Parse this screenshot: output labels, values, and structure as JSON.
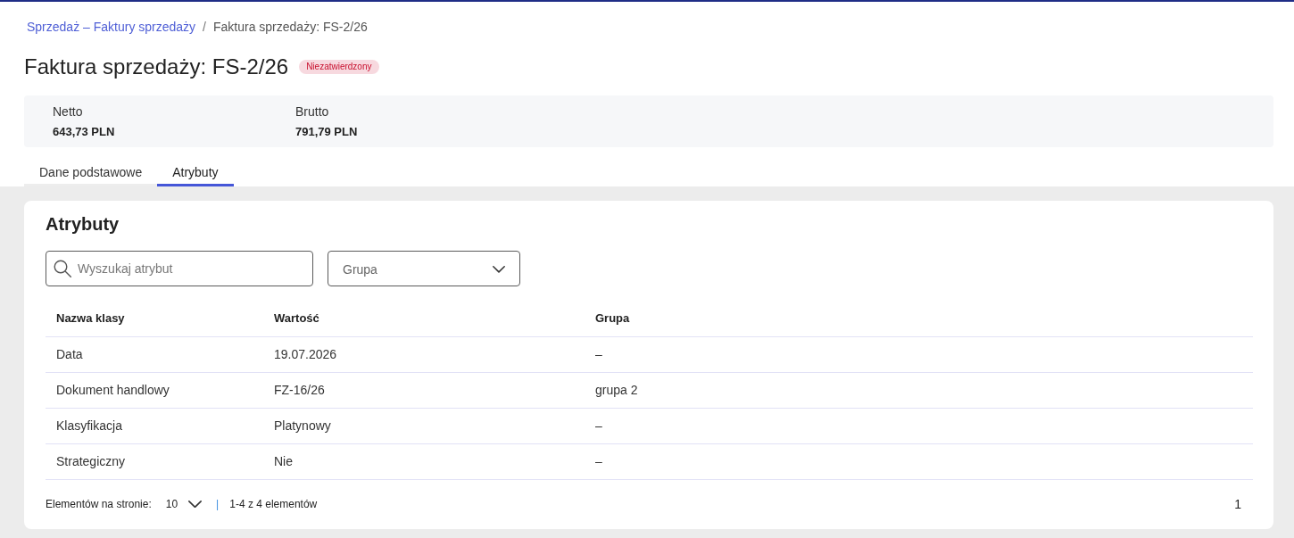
{
  "breadcrumb": {
    "separator": "/",
    "items": [
      {
        "label": "Sprzedaż – Faktury sprzedaży",
        "kind": "link"
      },
      {
        "label": "Faktura sprzedaży: FS-2/26",
        "kind": "current"
      }
    ]
  },
  "title": "Faktura sprzedaży: FS-2/26",
  "status": "Niezatwierdzony",
  "summary": [
    {
      "label": "Netto",
      "value": "643,73 PLN"
    },
    {
      "label": "Brutto",
      "value": "791,79 PLN"
    }
  ],
  "tabs": [
    {
      "label": "Dane podstawowe",
      "selected": false
    },
    {
      "label": "Atrybuty",
      "selected": true
    }
  ],
  "panel": {
    "title": "Atrybuty",
    "search": {
      "placeholder": "Wyszukaj atrybut"
    },
    "group_filter": {
      "placeholder": "Grupa"
    },
    "table": {
      "columns": [
        "Nazwa klasy",
        "Wartość",
        "Grupa"
      ],
      "rows": [
        [
          "Data",
          "19.07.2026",
          "–"
        ],
        [
          "Dokument handlowy",
          "FZ-16/26",
          "grupa 2"
        ],
        [
          "Klasyfikacja",
          "Platynowy",
          "–"
        ],
        [
          "Strategiczny",
          "Nie",
          "–"
        ]
      ]
    },
    "pagination": {
      "page_size_label": "Elementów na stronie:",
      "page_size": "10",
      "separator": "|",
      "range": "1-4 z 4 elementów",
      "pages": [
        {
          "label": "1",
          "selected": true
        }
      ]
    }
  }
}
